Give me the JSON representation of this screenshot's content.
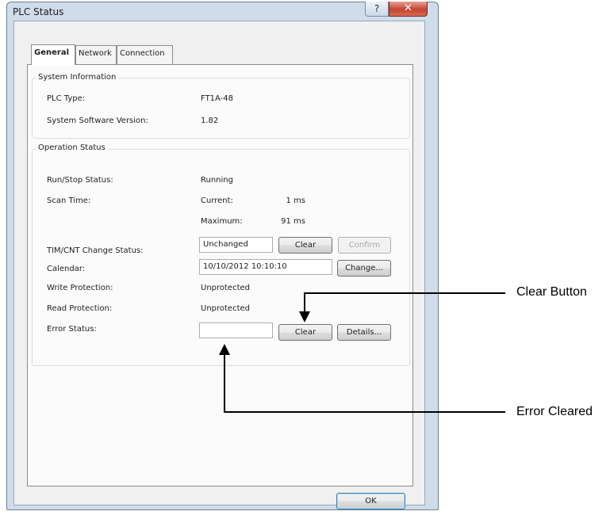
{
  "window": {
    "title": "PLC Status",
    "help_icon": "?",
    "close_icon": "✕"
  },
  "tabs": [
    {
      "label": "General",
      "selected": true
    },
    {
      "label": "Network",
      "selected": false
    },
    {
      "label": "Connection",
      "selected": false
    }
  ],
  "system_information": {
    "legend": "System Information",
    "plc_type_label": "PLC Type:",
    "plc_type_value": "FT1A-48",
    "software_version_label": "System Software Version:",
    "software_version_value": "1.82"
  },
  "operation_status": {
    "legend": "Operation Status",
    "run_stop_label": "Run/Stop Status:",
    "run_stop_value": "Running",
    "scan_time_label": "Scan Time:",
    "scan_current_label": "Current:",
    "scan_current_value": "1 ms",
    "scan_maximum_label": "Maximum:",
    "scan_maximum_value": "91 ms",
    "timcnt_label": "TIM/CNT Change Status:",
    "timcnt_value": "Unchanged",
    "timcnt_clear_button": "Clear",
    "timcnt_confirm_button": "Confirm",
    "calendar_label": "Calendar:",
    "calendar_value": "10/10/2012 10:10:10",
    "calendar_change_button": "Change...",
    "write_protection_label": "Write Protection:",
    "write_protection_value": "Unprotected",
    "read_protection_label": "Read Protection:",
    "read_protection_value": "Unprotected",
    "error_status_label": "Error Status:",
    "error_status_value": "",
    "error_clear_button": "Clear",
    "error_details_button": "Details..."
  },
  "ok_button": "OK",
  "annotations": {
    "clear_button": "Clear Button",
    "error_cleared": "Error Cleared"
  }
}
